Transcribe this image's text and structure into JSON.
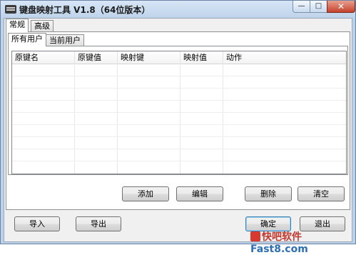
{
  "window": {
    "title": "键盘映射工具 V1.8（64位版本）",
    "controls": {
      "minimize": "—",
      "maximize": "□",
      "close": "✕"
    }
  },
  "main_tabs": [
    {
      "label": "常规",
      "active": true
    },
    {
      "label": "高级",
      "active": false
    }
  ],
  "user_tabs": [
    {
      "label": "所有用户",
      "active": true
    },
    {
      "label": "当前用户",
      "active": false
    }
  ],
  "table": {
    "columns": [
      "原键名",
      "原键值",
      "映射键",
      "映射值",
      "动作"
    ],
    "rows": []
  },
  "actions": {
    "add": "添加",
    "edit": "编辑",
    "delete": "删除",
    "clear": "清空"
  },
  "footer": {
    "import": "导入",
    "export": "导出",
    "ok": "确定",
    "exit": "退出"
  },
  "watermark": {
    "text1": "快吧软件",
    "text2": "Fast8.com"
  }
}
